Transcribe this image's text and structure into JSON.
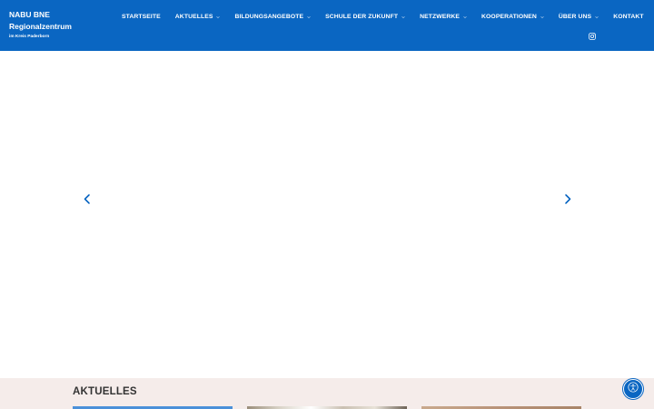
{
  "logo": {
    "line1": "NABU BNE",
    "line2": "Regionalzentrum",
    "line3": "im Kreis Paderborn"
  },
  "nav": {
    "items": [
      {
        "label": "STARTSEITE",
        "has_dropdown": false
      },
      {
        "label": "AKTUELLES",
        "has_dropdown": true
      },
      {
        "label": "BILDUNGSANGEBOTE",
        "has_dropdown": true
      },
      {
        "label": "SCHULE DER ZUKUNFT",
        "has_dropdown": true
      },
      {
        "label": "NETZWERKE",
        "has_dropdown": true
      },
      {
        "label": "KOOPERATIONEN",
        "has_dropdown": true
      },
      {
        "label": "ÜBER UNS",
        "has_dropdown": true
      },
      {
        "label": "KONTAKT",
        "has_dropdown": false
      }
    ],
    "social_icon": "instagram-icon"
  },
  "slider": {
    "prev_icon": "chevron-left-icon",
    "next_icon": "chevron-right-icon"
  },
  "news": {
    "title": "AKTUELLES"
  },
  "accessibility": {
    "icon": "accessibility-icon"
  },
  "colors": {
    "header_bg": "#0a66c2",
    "section_bg": "#f5ecea",
    "arrow": "#0a66c2"
  }
}
